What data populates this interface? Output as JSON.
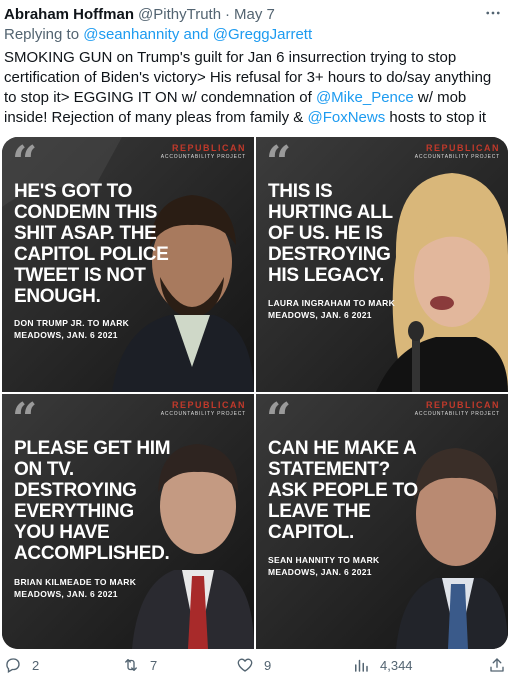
{
  "post": {
    "author_name": "Abraham Hoffman",
    "author_handle": "@PithyTruth",
    "separator": "·",
    "date": "May 7",
    "reply_prefix": "Replying to",
    "reply_mention_1": "@seanhannity",
    "reply_and": "and",
    "reply_mention_2": "@GreggJarrett",
    "text_lines": [
      "SMOKING GUN on Trump's guilt for Jan 6 insurrection trying to stop",
      "certification of Biden's victory> His refusal for 3+ hours to do/say anything",
      "to stop it> EGGING IT ON w/ condemnation of ",
      " w/ mob",
      "inside! Rejection of many pleas from family & ",
      " hosts to stop it"
    ],
    "mention_pence": "@Mike_Pence",
    "mention_foxnews": "@FoxNews"
  },
  "media": {
    "brand_name": "REPUBLICAN",
    "brand_sub": "ACCOUNTABILITY PROJECT",
    "quote_glyph": "“",
    "panels": [
      {
        "quote_lines": [
          "HE'S GOT TO",
          "CONDEMN THIS",
          "SHIT ASAP. THE",
          "CAPITOL POLICE",
          "TWEET IS NOT",
          "ENOUGH."
        ],
        "attr_lines": [
          "DON TRUMP JR. TO MARK",
          "MEADOWS, JAN. 6 2021"
        ]
      },
      {
        "quote_lines": [
          "THIS IS",
          "HURTING ALL",
          "OF US. HE IS",
          "DESTROYING",
          "HIS LEGACY."
        ],
        "attr_lines": [
          "LAURA INGRAHAM TO MARK",
          "MEADOWS, JAN. 6 2021"
        ]
      },
      {
        "quote_lines": [
          "PLEASE GET HIM",
          "ON TV.",
          "DESTROYING",
          "EVERYTHING",
          "YOU HAVE",
          "ACCOMPLISHED."
        ],
        "attr_lines": [
          "BRIAN KILMEADE TO MARK",
          "MEADOWS, JAN. 6 2021"
        ]
      },
      {
        "quote_lines": [
          "CAN HE MAKE A",
          "STATEMENT?",
          "ASK PEOPLE TO",
          "LEAVE THE",
          "CAPITOL."
        ],
        "attr_lines": [
          "SEAN HANNITY TO MARK",
          "MEADOWS, JAN. 6 2021"
        ]
      }
    ]
  },
  "actions": {
    "reply_count": "2",
    "retweet_count": "7",
    "like_count": "9",
    "views_count": "4,344"
  },
  "icons": {
    "more": "more-icon",
    "reply": "reply-icon",
    "retweet": "retweet-icon",
    "like": "heart-icon",
    "views": "views-icon",
    "share": "share-icon"
  },
  "colors": {
    "text": "#0f1419",
    "secondary": "#536471",
    "link": "#1d9bf0",
    "brand_red": "#c0392b"
  }
}
